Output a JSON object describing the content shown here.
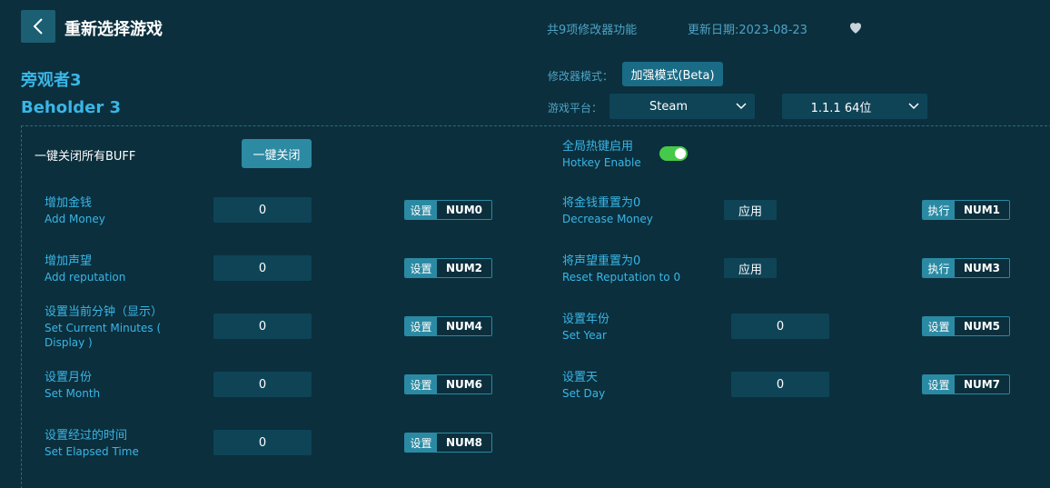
{
  "header": {
    "title": "重新选择游戏",
    "feature_count": "共9项修改器功能",
    "update_date": "更新日期:2023-08-23"
  },
  "game": {
    "name_cn": "旁观者3",
    "name_en": "Beholder 3"
  },
  "trainer": {
    "mode_label": "修改器模式：",
    "mode_value": "加强模式(Beta)",
    "platform_label": "游戏平台：",
    "platform_value": "Steam",
    "version_value": "1.1.1 64位"
  },
  "global": {
    "buff_label": "一键关闭所有BUFF",
    "close_all_label": "一键关闭",
    "hotkey_cn": "全局热键启用",
    "hotkey_en": "Hotkey Enable",
    "hotkey_enabled": true
  },
  "left_items": [
    {
      "cn": "增加金钱",
      "en": "Add Money",
      "value": "0",
      "hk_action": "设置",
      "hk_key": "NUM0"
    },
    {
      "cn": "增加声望",
      "en": "Add reputation",
      "value": "0",
      "hk_action": "设置",
      "hk_key": "NUM2"
    },
    {
      "cn": "设置当前分钟（显示）",
      "en": "Set Current Minutes ( Display )",
      "value": "0",
      "hk_action": "设置",
      "hk_key": "NUM4"
    },
    {
      "cn": "设置月份",
      "en": "Set Month",
      "value": "0",
      "hk_action": "设置",
      "hk_key": "NUM6"
    },
    {
      "cn": "设置经过的时间",
      "en": "Set Elapsed Time",
      "value": "0",
      "hk_action": "设置",
      "hk_key": "NUM8"
    }
  ],
  "right_items": [
    {
      "cn": "将金钱重置为0",
      "en": "Decrease Money",
      "button": "应用",
      "hk_action": "执行",
      "hk_key": "NUM1"
    },
    {
      "cn": "将声望重置为0",
      "en": "Reset Reputation to 0",
      "button": "应用",
      "hk_action": "执行",
      "hk_key": "NUM3"
    },
    {
      "cn": "设置年份",
      "en": "Set Year",
      "value": "0",
      "hk_action": "设置",
      "hk_key": "NUM5"
    },
    {
      "cn": "设置天",
      "en": "Set Day",
      "value": "0",
      "hk_action": "设置",
      "hk_key": "NUM7"
    }
  ],
  "colors": {
    "background": "#0b2f3d",
    "accent": "#39b6e6",
    "button": "#2c8aa3",
    "toggle_on": "#45c94a"
  }
}
